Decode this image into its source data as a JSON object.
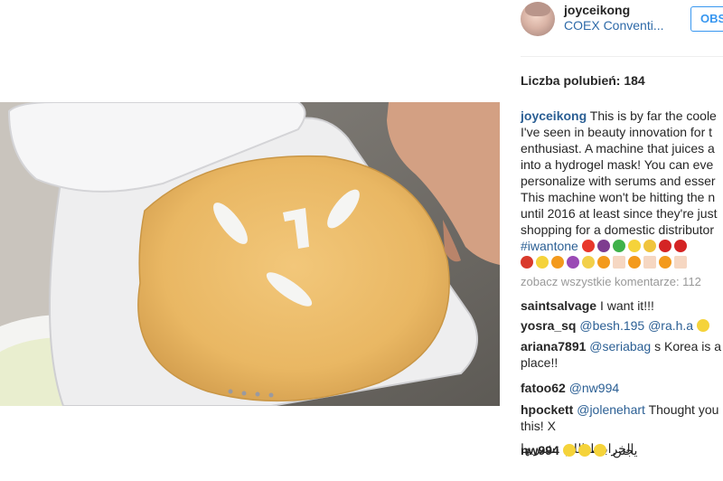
{
  "post": {
    "username": "joyceikong",
    "location": "COEX Conventi...",
    "follow_label": "OBS",
    "likes_text": "Liczba polubień: 184"
  },
  "caption": {
    "username": "joyceikong",
    "lines": [
      "This is by far the coole",
      "I've seen in beauty innovation for t",
      "enthusiast. A machine that juices a",
      "into a hydrogel mask! You can eve",
      "personalize with serums and esser",
      "This machine won't be hitting the n",
      "until 2016 at least since they're just",
      "shopping for a domestic distributor"
    ],
    "hashtag": "#iwantone",
    "emojis_row1": [
      "tomato",
      "eggplant",
      "watermelon",
      "lemon",
      "corn",
      "cherry",
      "cherry"
    ],
    "emojis_row2": [
      "apple",
      "lemon",
      "orange",
      "grape",
      "banana",
      "face",
      "square",
      "face",
      "square",
      "face",
      "square"
    ]
  },
  "comments_link": "zobacz wszystkie komentarze: 112",
  "comments": [
    {
      "user": "saintsalvage",
      "mention": "",
      "text": "I want it!!!"
    },
    {
      "user": "yosra_sq",
      "mention": "@besh.195 @ra.h.a",
      "text": ""
    },
    {
      "user": "ariana7891",
      "mention": "@seriabag",
      "text": "s Korea is a",
      "text2": "place!!"
    },
    {
      "user": "fatoo62",
      "mention": "@nw994",
      "text": ""
    },
    {
      "user": "hpockett",
      "mention": "@jolenehart",
      "text": "Thought you",
      "text2": "this! X"
    },
    {
      "user": "",
      "mention": "",
      "text": "الخرابيط اللي نشتريها"
    },
    {
      "user": "nw994",
      "mention": "",
      "text": "يجنن"
    }
  ]
}
